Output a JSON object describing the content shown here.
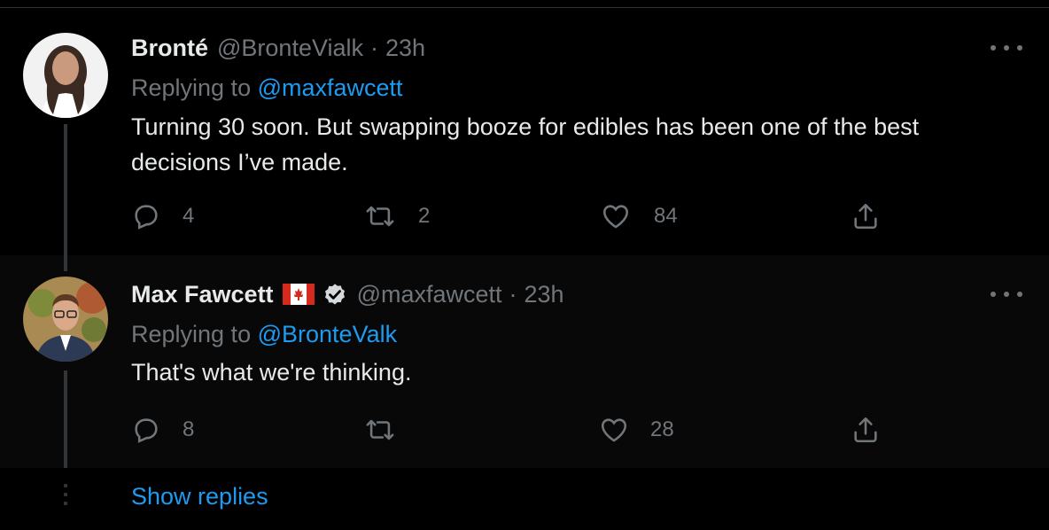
{
  "tweets": [
    {
      "display_name": "Bronté",
      "handle": "@BronteVialk",
      "separator": "·",
      "time": "23h",
      "replying_prefix": "Replying to",
      "replying_to": "@maxfawcett",
      "text": "Turning 30 soon. But swapping booze for edibles has been one of the best decisions I’ve made.",
      "replies": "4",
      "retweets": "2",
      "likes": "84"
    },
    {
      "display_name": "Max Fawcett",
      "handle": "@maxfawcett",
      "separator": "·",
      "time": "23h",
      "replying_prefix": "Replying to",
      "replying_to": "@BronteValk",
      "text": "That's what we're thinking.",
      "replies": "8",
      "retweets": "",
      "likes": "28",
      "flag_icon": "canada-flag-icon",
      "verified_icon": "verified-badge-icon"
    }
  ],
  "show_replies": "Show replies",
  "colors": {
    "background": "#000000",
    "text": "#e7e9ea",
    "secondary": "#71767b",
    "accent": "#1d9bf0"
  }
}
